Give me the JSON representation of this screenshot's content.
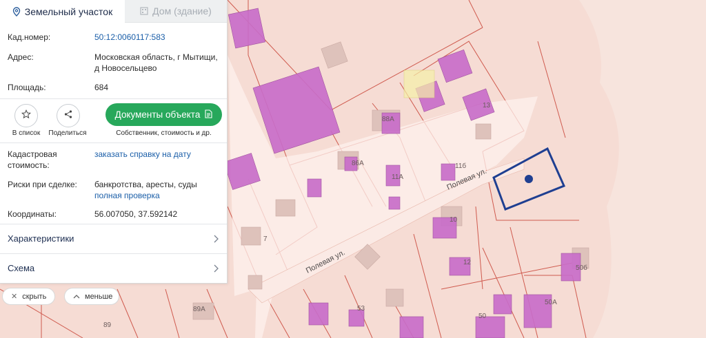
{
  "panel": {
    "tabs": [
      {
        "label": "Земельный участок",
        "icon": "map-pin-icon"
      },
      {
        "label": "Дом (здание)",
        "icon": "building-icon"
      }
    ],
    "fields": {
      "cad_label": "Кад.номер:",
      "cad_value": "50:12:0060117:583",
      "address_label": "Адрес:",
      "address_value": "Московская область, г Мытищи, д Новосельцево",
      "area_label": "Площадь:",
      "area_value": "684",
      "cad_cost_label": "Кадастровая стоимость:",
      "cad_cost_link": "заказать справку на дату",
      "risks_label": "Риски при сделке:",
      "risks_value": "банкротства, аресты, суды",
      "risks_link": "полная проверка",
      "coords_label": "Координаты:",
      "coords_value": "56.007050, 37.592142"
    },
    "actions": {
      "to_list": "В список",
      "share": "Поделиться",
      "docs_button": "Документы объекта",
      "docs_caption": "Собственник, стоимость и др."
    },
    "sections": [
      {
        "label": "Характеристики"
      },
      {
        "label": "Схема"
      }
    ]
  },
  "controls": {
    "hide": "скрыть",
    "less": "меньше"
  },
  "map": {
    "street_labels": [
      "Полевая ул.",
      "Полевая ул."
    ],
    "house_numbers": [
      "88А",
      "86А",
      "11А",
      "11б",
      "13",
      "10",
      "12",
      "7",
      "53",
      "50",
      "50А",
      "50б",
      "89А",
      "89"
    ],
    "colors": {
      "background": "#f6dcd4",
      "plot_border": "#cf5a4e",
      "building": "#c86dc9",
      "selected_outline": "#1f3f91",
      "road": "#fdf1ee",
      "accent_green": "#27a85b"
    }
  }
}
